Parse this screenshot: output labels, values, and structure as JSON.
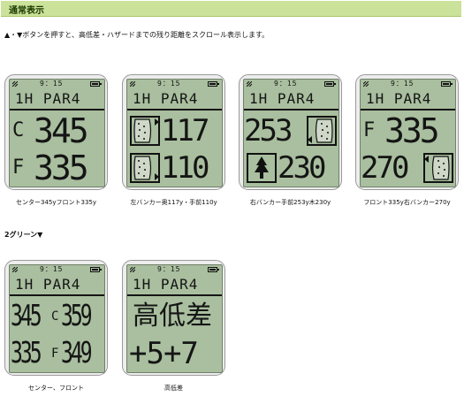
{
  "header": {
    "title": "通常表示"
  },
  "description": "▲・▼ボタンを押すと、高低差・ハザードまでの残り距離をスクロール表示します。",
  "status": {
    "time": "9：15"
  },
  "hole": "1H PAR4",
  "screens": [
    {
      "row1": {
        "label": "C",
        "value": "345"
      },
      "row2": {
        "label": "F",
        "value": "335"
      },
      "caption": "センター345yフロント335y"
    },
    {
      "row1": {
        "icon": "bunker-left-icon",
        "value": "117"
      },
      "row2": {
        "icon": "bunker-left-front-icon",
        "value": "110"
      },
      "caption": "左バンカー奥117y・手前110y"
    },
    {
      "row1": {
        "value": "253",
        "icon": "bunker-right-icon"
      },
      "row2": {
        "icon": "tree-icon",
        "value": "230"
      },
      "caption": "右バンカー手前253y木230y"
    },
    {
      "row1": {
        "label": "F",
        "value": "335"
      },
      "row2": {
        "value": "270",
        "icon": "bunker-right-far-icon"
      },
      "caption": "フロント335y右バンカー270y"
    }
  ],
  "section2": {
    "title": "2グリーン▼"
  },
  "screens2": [
    {
      "row1": {
        "left": "345",
        "label": "C",
        "right": "359"
      },
      "row2": {
        "left": "335",
        "label": "F",
        "right": "349"
      },
      "caption": "センター、フロント"
    },
    {
      "row1": {
        "text": "高低差"
      },
      "row2": {
        "text": "+5+7"
      },
      "caption": "高低差"
    }
  ]
}
